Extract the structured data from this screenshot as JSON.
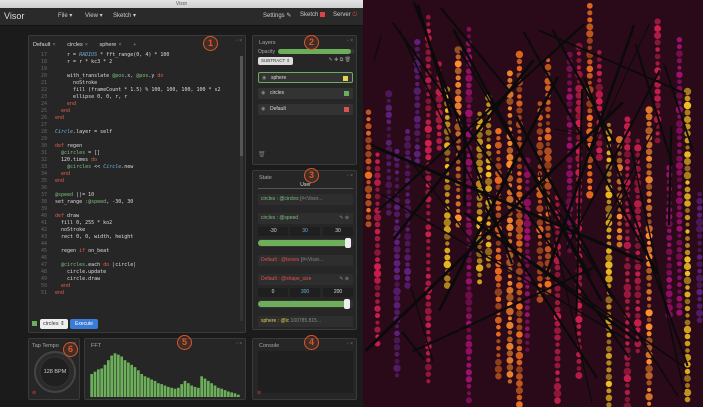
{
  "window": {
    "title": "Visor"
  },
  "menubar": {
    "app_name": "Visor",
    "menus": [
      "File ▾",
      "View ▾",
      "Sketch ▾"
    ],
    "settings": "Settings",
    "sketch": "Sketch",
    "server": "Server"
  },
  "editor": {
    "tabs": [
      "Default",
      "circles",
      "sphere"
    ],
    "tab_add": "+",
    "lines": [
      {
        "n": "17",
        "t": "    r = RADIUS * fft_range(0, 4) * 100"
      },
      {
        "n": "18",
        "t": "    r = r * kc3 * 2"
      },
      {
        "n": "19",
        "t": ""
      },
      {
        "n": "20",
        "t": "    with_translate @pos.x, @pos.y do"
      },
      {
        "n": "21",
        "t": "      noStroke"
      },
      {
        "n": "22",
        "t": "      fill (frameCount * 1.5) % 100, 100, 100, 100 * s2"
      },
      {
        "n": "23",
        "t": "      ellipse 0, 0, r, r"
      },
      {
        "n": "24",
        "t": "    end"
      },
      {
        "n": "25",
        "t": "  end"
      },
      {
        "n": "26",
        "t": "end"
      },
      {
        "n": "27",
        "t": ""
      },
      {
        "n": "28",
        "t": "Circle.layer = self"
      },
      {
        "n": "29",
        "t": ""
      },
      {
        "n": "30",
        "t": "def regen"
      },
      {
        "n": "31",
        "t": "  @circles = []"
      },
      {
        "n": "32",
        "t": "  120.times do"
      },
      {
        "n": "33",
        "t": "    @circles << Circle.new"
      },
      {
        "n": "34",
        "t": "  end"
      },
      {
        "n": "35",
        "t": "end"
      },
      {
        "n": "36",
        "t": ""
      },
      {
        "n": "37",
        "t": "@speed ||= 10"
      },
      {
        "n": "38",
        "t": "set_range :@speed, -30, 30"
      },
      {
        "n": "39",
        "t": ""
      },
      {
        "n": "40",
        "t": "def draw"
      },
      {
        "n": "41",
        "t": "  fill 0, 255 * ko2"
      },
      {
        "n": "42",
        "t": "  noStroke"
      },
      {
        "n": "43",
        "t": "  rect 0, 0, width, height"
      },
      {
        "n": "44",
        "t": ""
      },
      {
        "n": "45",
        "t": "  regen if on_beat"
      },
      {
        "n": "46",
        "t": ""
      },
      {
        "n": "47",
        "t": "  @circles.each do |circle|"
      },
      {
        "n": "48",
        "t": "    circle.update"
      },
      {
        "n": "49",
        "t": "    circle.draw"
      },
      {
        "n": "50",
        "t": "  end"
      },
      {
        "n": "51",
        "t": "end"
      }
    ],
    "layer_select": "circles",
    "execute_label": "Execute"
  },
  "layers": {
    "title": "Layers",
    "opacity_label": "Opacity",
    "opacity": 0.95,
    "blend_mode": "SUBTRACT",
    "items": [
      {
        "name": "sphere",
        "color": "#e8d050"
      },
      {
        "name": "circles",
        "color": "#6cae5a"
      },
      {
        "name": "Default",
        "color": "#e05050"
      }
    ]
  },
  "state": {
    "title": "State",
    "user_tab": "User",
    "rows": [
      {
        "prefix": "circles",
        "name": "@circles",
        "value": "[#<Visor..."
      },
      {
        "prefix": "circles",
        "name": "@speed"
      },
      {
        "prefix": "Default",
        "name": "@boxes",
        "value": "[#<Visor..."
      },
      {
        "prefix": "Default",
        "name": "@shape_size"
      },
      {
        "prefix": "sphere",
        "name": "@lc",
        "value": "100785.815..."
      }
    ],
    "speed_min": "-30",
    "speed_val": "30",
    "speed_max": "30",
    "speed_level": 0.98,
    "size_min": "0",
    "size_val": "300",
    "size_max": "200",
    "size_level": 0.97
  },
  "taptempo": {
    "title": "Tap Tempo",
    "bpm": "128 BPM"
  },
  "fft": {
    "title": "FFT",
    "levels": [
      0.5,
      0.55,
      0.6,
      0.62,
      0.7,
      0.8,
      0.9,
      0.95,
      0.92,
      0.88,
      0.8,
      0.75,
      0.7,
      0.65,
      0.58,
      0.5,
      0.45,
      0.42,
      0.38,
      0.35,
      0.3,
      0.28,
      0.25,
      0.22,
      0.2,
      0.18,
      0.2,
      0.28,
      0.35,
      0.3,
      0.25,
      0.22,
      0.2,
      0.45,
      0.4,
      0.35,
      0.3,
      0.25,
      0.2,
      0.18,
      0.15,
      0.12,
      0.1,
      0.08,
      0.05
    ]
  },
  "console": {
    "title": "Console"
  },
  "badges": [
    "1",
    "2",
    "3",
    "4",
    "5",
    "6"
  ],
  "colors": {
    "accent": "#d9572b",
    "green": "#6cae5a",
    "blue": "#3a7bd5"
  }
}
